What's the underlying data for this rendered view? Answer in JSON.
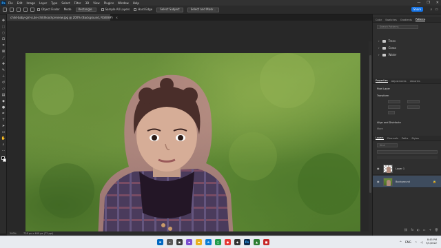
{
  "menubar": {
    "logo": "Ps",
    "items": [
      "File",
      "Edit",
      "Image",
      "Layer",
      "Type",
      "Select",
      "Filter",
      "3D",
      "View",
      "Plugins",
      "Window",
      "Help"
    ],
    "window_controls": [
      "—",
      "❐",
      "✕"
    ]
  },
  "options": {
    "object_finder_label": "Object Finder",
    "mode_label": "Mode",
    "mode_value": "Rectangle",
    "sample_all_layers_label": "Sample All Layers",
    "hard_edge_label": "Hard Edge",
    "select_subject_label": "Select Subject",
    "select_mask_label": "Select and Mask...",
    "share_label": "Share"
  },
  "document": {
    "tab_title": "child-baby-girl-cute-childhood-preview.jpg @ 200% (Background, RGB/8#)",
    "close": "×"
  },
  "status": {
    "zoom": "200%",
    "dimensions": "728 px x 460 px (72 ppi)"
  },
  "panels": {
    "top_tabs": [
      "Color",
      "Swatches",
      "Gradients",
      "Patterns"
    ],
    "active_top_tab": "Patterns",
    "search_placeholder": "Search Patterns",
    "pattern_folders": [
      "Trees",
      "Grass",
      "Water"
    ],
    "props_tabs": [
      "Properties",
      "Adjustments",
      "Libraries"
    ],
    "pixel_layer_label": "Pixel Layer",
    "transform_label": "Transform",
    "align_label": "Align and Distribute",
    "more_label": "More",
    "layers_tabs": [
      "Layers",
      "Channels",
      "Paths",
      "Styles"
    ],
    "kind_label": "Kind",
    "layers": [
      {
        "name": "Layer 1",
        "type": "transparent"
      },
      {
        "name": "Background",
        "type": "photo"
      }
    ]
  },
  "taskbar": {
    "lang": "ENG",
    "time": "8:45 PM",
    "date": "9/1/2022"
  }
}
